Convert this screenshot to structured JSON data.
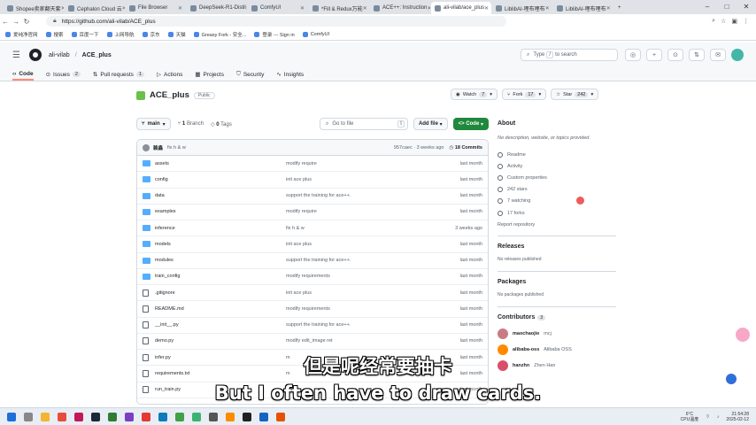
{
  "browser": {
    "tabs": [
      {
        "label": "Shopee卖家翻天套"
      },
      {
        "label": "Cephalon Cloud 云"
      },
      {
        "label": "File Browser"
      },
      {
        "label": "DeepSeek-R1-Distil"
      },
      {
        "label": "ComfyUI"
      },
      {
        "label": "*Fill & Redux万能"
      },
      {
        "label": "ACE++: Instruction"
      },
      {
        "label": "ali-vilab/ace_plus"
      },
      {
        "label": "LiblibAI-哩布哩布"
      },
      {
        "label": "LiblibAI-哩布哩布"
      }
    ],
    "url": "https://github.com/ali-vilab/ACE_plus",
    "bookmarks": [
      {
        "label": "爱纯净官网"
      },
      {
        "label": "搜索"
      },
      {
        "label": "百度一下"
      },
      {
        "label": "上网导航"
      },
      {
        "label": "京东"
      },
      {
        "label": "天猫"
      },
      {
        "label": "Greasy Fork - 安全..."
      },
      {
        "label": "登录 --- Sign in"
      },
      {
        "label": "ComfyUI"
      }
    ]
  },
  "header": {
    "owner": "ali-vilab",
    "separator": "/",
    "repo": "ACE_plus",
    "search_prefix": "Type",
    "search_key": "/",
    "search_suffix": "to search"
  },
  "repo_nav": [
    {
      "label": "Code",
      "count": ""
    },
    {
      "label": "Issues",
      "count": "2"
    },
    {
      "label": "Pull requests",
      "count": "1"
    },
    {
      "label": "Actions",
      "count": ""
    },
    {
      "label": "Projects",
      "count": ""
    },
    {
      "label": "Security",
      "count": ""
    },
    {
      "label": "Insights",
      "count": ""
    }
  ],
  "repo": {
    "name": "ACE_plus",
    "visibility": "Public",
    "watch_label": "Watch",
    "watch_count": "7",
    "fork_label": "Fork",
    "fork_count": "17",
    "star_label": "Star",
    "star_count": "242"
  },
  "toolbar": {
    "branch": "main",
    "branches_count": "1",
    "branches_label": "Branch",
    "tags_count": "0",
    "tags_label": "Tags",
    "go_to_file": "Go to file",
    "go_to_file_key": "t",
    "add_file": "Add file",
    "code": "Code"
  },
  "commit": {
    "author": "赖鑫",
    "message": "fix h & w",
    "hash_age": "957caec · 3 weeks ago",
    "commits": "18 Commits"
  },
  "files": [
    {
      "name": "assets",
      "type": "folder",
      "message": "modify require",
      "age": "last month"
    },
    {
      "name": "config",
      "type": "folder",
      "message": "init ace plus",
      "age": "last month"
    },
    {
      "name": "data",
      "type": "folder",
      "message": "support the training for ace++.",
      "age": "last month"
    },
    {
      "name": "examples",
      "type": "folder",
      "message": "modify require",
      "age": "last month"
    },
    {
      "name": "inference",
      "type": "folder",
      "message": "fix h & w",
      "age": "3 weeks ago"
    },
    {
      "name": "models",
      "type": "folder",
      "message": "init ace plus",
      "age": "last month"
    },
    {
      "name": "modules",
      "type": "folder",
      "message": "support the training for ace++.",
      "age": "last month"
    },
    {
      "name": "train_config",
      "type": "folder",
      "message": "modify requirements",
      "age": "last month"
    },
    {
      "name": ".gitignore",
      "type": "file",
      "message": "init ace plus",
      "age": "last month"
    },
    {
      "name": "README.md",
      "type": "file",
      "message": "modify requirements",
      "age": "last month"
    },
    {
      "name": "__init__.py",
      "type": "file",
      "message": "support the training for ace++.",
      "age": "last month"
    },
    {
      "name": "demo.py",
      "type": "file",
      "message": "modify edit_image ret",
      "age": "last month"
    },
    {
      "name": "infer.py",
      "type": "file",
      "message": "m",
      "age": "last month"
    },
    {
      "name": "requirements.txt",
      "type": "file",
      "message": "m",
      "age": "last month"
    },
    {
      "name": "run_train.py",
      "type": "file",
      "message": "",
      "age": "last month"
    }
  ],
  "about": {
    "title": "About",
    "description": "No description, website, or topics provided.",
    "items": [
      {
        "icon": "book-icon",
        "text": "Readme"
      },
      {
        "icon": "pulse-icon",
        "text": "Activity"
      },
      {
        "icon": "sliders-icon",
        "text": "Custom properties"
      },
      {
        "icon": "star-icon",
        "text": "242 stars"
      },
      {
        "icon": "eye-icon",
        "text": "7 watching"
      },
      {
        "icon": "fork-icon",
        "text": "17 forks"
      }
    ],
    "report": "Report repository"
  },
  "releases": {
    "title": "Releases",
    "empty": "No releases published"
  },
  "packages": {
    "title": "Packages",
    "empty": "No packages published"
  },
  "contributors": {
    "title": "Contributors",
    "count": "3",
    "list": [
      {
        "login": "maochaojie",
        "name": "mcj",
        "color": "#c97b84"
      },
      {
        "login": "alibaba-oss",
        "name": "Alibaba OSS",
        "color": "#ff8a00"
      },
      {
        "login": "hanzhn",
        "name": "Zhen Han",
        "color": "#d94f6b"
      }
    ]
  },
  "subtitles": {
    "zh": "但是呢经常要抽卡",
    "en": "But I often have to draw cards."
  },
  "taskbar": {
    "weather_temp": "6°C",
    "weather_label": "CPU温度",
    "time": "21:54:28",
    "date": "2025-02-12"
  },
  "colors": {
    "accent_green": "#1f883d",
    "tab_underline": "#fd8c73",
    "folder": "#54aeff"
  }
}
